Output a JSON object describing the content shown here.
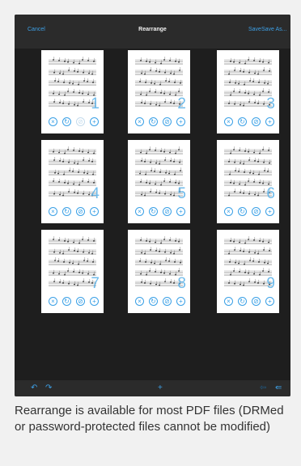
{
  "toolbar": {
    "cancel_label": "Cancel",
    "title": "Rearrange",
    "save_label": "Save",
    "save_as_label": "Save As..."
  },
  "pages": [
    {
      "number": "1"
    },
    {
      "number": "2"
    },
    {
      "number": "3"
    },
    {
      "number": "4"
    },
    {
      "number": "5"
    },
    {
      "number": "6"
    },
    {
      "number": "7"
    },
    {
      "number": "8"
    },
    {
      "number": "9"
    }
  ],
  "page_controls": {
    "delete_icon": "close-circle-icon",
    "rotate_icon": "rotate-circle-icon",
    "edit_icon": "edit-circle-icon",
    "add_icon": "add-circle-icon"
  },
  "bottom_bar": {
    "rotate_left_icon": "rotate-left-icon",
    "rotate_right_icon": "rotate-right-icon",
    "add_icon": "plus-icon",
    "undo_icon": "undo-icon",
    "redo_icon": "redo-icon"
  },
  "caption": "Rearrange is available for most PDF files (DRMed or password-protected files cannot be modified)",
  "colors": {
    "accent": "#3da0e6",
    "background": "#1e1e1e",
    "toolbar": "#2b2b2b"
  }
}
